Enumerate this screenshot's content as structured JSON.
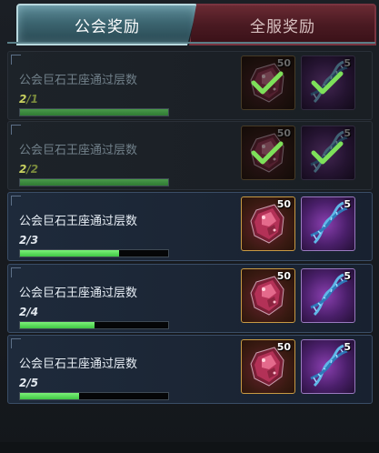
{
  "tabs": {
    "guild": "公会奖励",
    "server": "全服奖励"
  },
  "rows": [
    {
      "title": "公会巨石王座通过层数",
      "current": "2",
      "total": "/1",
      "progress": 1.0,
      "done": true,
      "rewards": [
        {
          "icon": "gem-icon",
          "count": "50"
        },
        {
          "icon": "dna-icon",
          "count": "5"
        }
      ]
    },
    {
      "title": "公会巨石王座通过层数",
      "current": "2",
      "total": "/2",
      "progress": 1.0,
      "done": true,
      "rewards": [
        {
          "icon": "gem-icon",
          "count": "50"
        },
        {
          "icon": "dna-icon",
          "count": "5"
        }
      ]
    },
    {
      "title": "公会巨石王座通过层数",
      "current": "2",
      "total": "/3",
      "progress": 0.67,
      "done": false,
      "rewards": [
        {
          "icon": "gem-icon",
          "count": "50"
        },
        {
          "icon": "dna-icon",
          "count": "5"
        }
      ]
    },
    {
      "title": "公会巨石王座通过层数",
      "current": "2",
      "total": "/4",
      "progress": 0.5,
      "done": false,
      "rewards": [
        {
          "icon": "gem-icon",
          "count": "50"
        },
        {
          "icon": "dna-icon",
          "count": "5"
        }
      ]
    },
    {
      "title": "公会巨石王座通过层数",
      "current": "2",
      "total": "/5",
      "progress": 0.4,
      "done": false,
      "rewards": [
        {
          "icon": "gem-icon",
          "count": "50"
        },
        {
          "icon": "dna-icon",
          "count": "5"
        }
      ]
    }
  ],
  "colors": {
    "progress_fill": "#4fd150",
    "check": "#7ee05a"
  }
}
